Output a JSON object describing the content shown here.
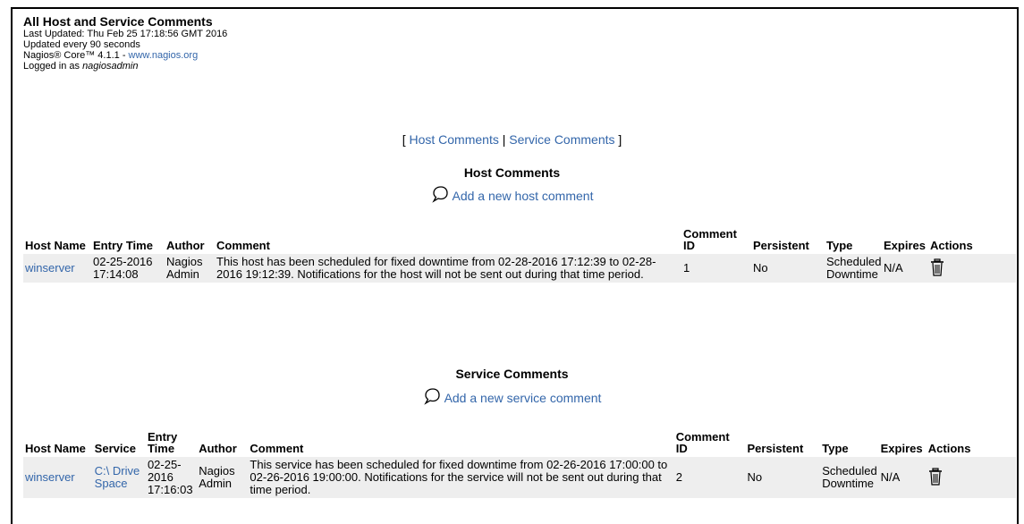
{
  "header": {
    "title": "All Host and Service Comments",
    "last_updated": "Last Updated: Thu Feb 25 17:18:56 GMT 2016",
    "update_interval": "Updated every 90 seconds",
    "version_prefix": "Nagios® Core™ 4.1.1 - ",
    "site_link": "www.nagios.org",
    "logged_prefix": "Logged in as ",
    "user": "nagiosadmin"
  },
  "nav": {
    "open": "[ ",
    "host_link": "Host Comments",
    "sep": " | ",
    "service_link": "Service Comments",
    "close": " ]"
  },
  "host_section": {
    "title": "Host Comments",
    "add_link": "Add a new host comment",
    "headers": {
      "host_name": "Host Name",
      "entry_time": "Entry Time",
      "author": "Author",
      "comment": "Comment",
      "comment_id": "Comment ID",
      "persistent": "Persistent",
      "type": "Type",
      "expires": "Expires",
      "actions": "Actions"
    },
    "rows": [
      {
        "host": "winserver",
        "entry_time": "02-25-2016 17:14:08",
        "author": "Nagios Admin",
        "comment": "This host has been scheduled for fixed downtime from 02-28-2016 17:12:39 to 02-28-2016 19:12:39. Notifications for the host will not be sent out during that time period.",
        "comment_id": "1",
        "persistent": "No",
        "type": "Scheduled Downtime",
        "expires": "N/A",
        "action_icon": "trash-icon"
      }
    ]
  },
  "service_section": {
    "title": "Service Comments",
    "add_link": "Add a new service comment",
    "headers": {
      "host_name": "Host Name",
      "service": "Service",
      "entry_time": "Entry Time",
      "author": "Author",
      "comment": "Comment",
      "comment_id": "Comment ID",
      "persistent": "Persistent",
      "type": "Type",
      "expires": "Expires",
      "actions": "Actions"
    },
    "rows": [
      {
        "host": "winserver",
        "service": "C:\\ Drive Space",
        "entry_time": "02-25-2016 17:16:03",
        "author": "Nagios Admin",
        "comment": "This service has been scheduled for fixed downtime from 02-26-2016 17:00:00 to 02-26-2016 19:00:00. Notifications for the service will not be sent out during that time period.",
        "comment_id": "2",
        "persistent": "No",
        "type": "Scheduled Downtime",
        "expires": "N/A",
        "action_icon": "trash-icon"
      }
    ]
  }
}
